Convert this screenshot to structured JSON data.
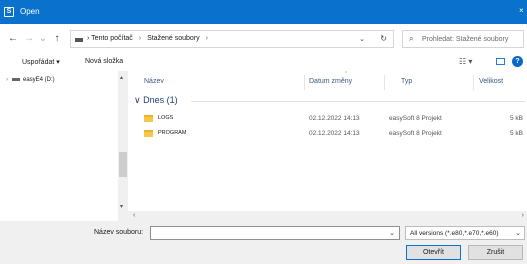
{
  "window": {
    "title": "Open",
    "app_icon_glyph": "S",
    "close_glyph": "×"
  },
  "address": {
    "back_glyph": "←",
    "forward_glyph": "→",
    "recent_glyph": "⌄",
    "up_glyph": "↑",
    "crumbs": [
      "Tento počítač",
      "Stažené soubory"
    ],
    "crumb_sep": "›",
    "dropdown_glyph": "⌄",
    "refresh_glyph": "↻"
  },
  "search": {
    "placeholder": "Prohledat: Stažené soubory",
    "icon": "⌕"
  },
  "toolbar": {
    "organize_label": "Uspořádat ▾",
    "new_folder_label": "Nová složka",
    "view_glyph": "☷ ▾",
    "help_glyph": "?"
  },
  "nav": {
    "items": [
      {
        "expand": "›",
        "label": "easyE4 (D:)"
      }
    ]
  },
  "columns": {
    "name": "Název",
    "date": "Datum změny",
    "type": "Typ",
    "size": "Velikost",
    "sort_glyph": "⌃"
  },
  "group": {
    "label": "∨ Dnes (1)"
  },
  "files": [
    {
      "name": "LOGS",
      "date": "02.12.2022 14:13",
      "type": "easySoft 8 Projekt",
      "size": "5 kB"
    },
    {
      "name": "PROGRAM",
      "date": "02.12.2022 14:13",
      "type": "easySoft 8 Projekt",
      "size": "5 kB"
    }
  ],
  "scroll": {
    "up": "▴",
    "down": "▾",
    "left": "‹",
    "right": "›"
  },
  "bottom": {
    "filename_label": "Název souboru:",
    "filename_value": "",
    "filter_value": "All versions (*.e80,*.e70,*.e60)",
    "open_label": "Otevřít",
    "cancel_label": "Zrušit",
    "caret": "⌄"
  },
  "colors": {
    "titlebar": "#0a72cc",
    "folder": "#f5c744",
    "accent": "#0a68c9"
  }
}
